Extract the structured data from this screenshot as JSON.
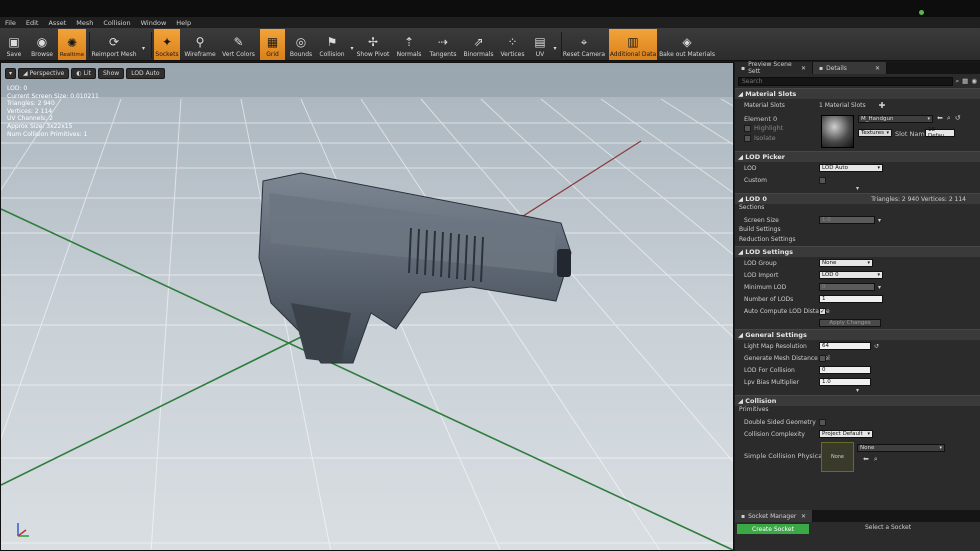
{
  "menu": [
    "File",
    "Edit",
    "Asset",
    "Mesh",
    "Collision",
    "Window",
    "Help"
  ],
  "toolbar": {
    "items": [
      {
        "label": "Save",
        "icon": "save-icon",
        "active": false
      },
      {
        "label": "Browse",
        "icon": "browse-icon",
        "active": false
      },
      {
        "label": "Reimport Mesh",
        "icon": "reimport-icon",
        "active": false
      },
      {
        "label": "Sockets",
        "icon": "sockets-icon",
        "active": true
      },
      {
        "label": "Wireframe",
        "icon": "wireframe-icon",
        "active": false
      },
      {
        "label": "Vert Colors",
        "icon": "vert-colors-icon",
        "active": false
      },
      {
        "label": "Grid",
        "icon": "grid-icon",
        "active": true
      },
      {
        "label": "Bounds",
        "icon": "bounds-icon",
        "active": false
      },
      {
        "label": "Collision",
        "icon": "collision-icon",
        "active": false
      },
      {
        "label": "Show Pivot",
        "icon": "pivot-icon",
        "active": false
      },
      {
        "label": "Normals",
        "icon": "normals-icon",
        "active": false
      },
      {
        "label": "Tangents",
        "icon": "tangents-icon",
        "active": false
      },
      {
        "label": "Binormals",
        "icon": "binormals-icon",
        "active": false
      },
      {
        "label": "Vertices",
        "icon": "vertices-icon",
        "active": false
      },
      {
        "label": "UV",
        "icon": "uv-icon",
        "active": false
      },
      {
        "label": "Reset Camera",
        "icon": "reset-camera-icon",
        "active": false
      },
      {
        "label": "Additional Data",
        "icon": "additional-data-icon",
        "active": true
      },
      {
        "label": "Bake out Materials",
        "icon": "bake-materials-icon",
        "active": false
      }
    ]
  },
  "viewport": {
    "buttons": {
      "perspective": "Perspective",
      "lit": "Lit",
      "show": "Show",
      "lod": "LOD Auto"
    },
    "stats": [
      "LOD: 0",
      "Current Screen Size: 0.010211",
      "Triangles: 2 940",
      "Vertices: 2 114",
      "UV Channels: 2",
      "Approx Size: 3x22x15",
      "Num Collision Primitives: 1"
    ]
  },
  "panel_tabs": {
    "preview": "Preview Scene Sett",
    "details": "Details"
  },
  "details": {
    "search_placeholder": "Search",
    "material_slots": {
      "title": "Material Slots",
      "label": "Material Slots",
      "count": "1 Material Slots",
      "element": "Element 0",
      "highlight": "Highlight",
      "isolate": "Isolate",
      "material": "M_Handgun",
      "textures": "Textures",
      "slot_name_label": "Slot Name",
      "slot_name": "18 - Defau"
    },
    "lod_picker": {
      "title": "LOD Picker",
      "lod_label": "LOD",
      "lod_value": "LOD Auto",
      "custom_label": "Custom"
    },
    "lod0": {
      "title": "LOD 0",
      "stats": "Triangles: 2 940    Vertices: 2 114",
      "sections": "Sections",
      "screen_size_label": "Screen Size",
      "screen_size": "1.0",
      "build_settings": "Build Settings",
      "reduction_settings": "Reduction Settings"
    },
    "lod_settings": {
      "title": "LOD Settings",
      "group_label": "LOD Group",
      "group": "None",
      "import_label": "LOD Import",
      "import": "LOD 0",
      "min_label": "Minimum LOD",
      "min": "0",
      "num_label": "Number of LODs",
      "num": "1",
      "auto_label": "Auto Compute LOD Distance",
      "apply": "Apply Changes"
    },
    "general": {
      "title": "General Settings",
      "lightmap_label": "Light Map Resolution",
      "lightmap": "64",
      "distfield_label": "Generate Mesh Distance Fiel",
      "lodcoll_label": "LOD For Collision",
      "lodcoll": "0",
      "lpv_label": "Lpv Bias Multiplier",
      "lpv": "1.0"
    },
    "collision": {
      "title": "Collision",
      "primitives": "Primitives",
      "double_label": "Double Sided Geometry",
      "complexity_label": "Collision Complexity",
      "complexity": "Project Default",
      "simple_label": "Simple Collision Physical Ma",
      "thumb": "None",
      "phys_value": "None"
    }
  },
  "socket": {
    "tab": "Socket Manager",
    "create": "Create Socket",
    "select": "Select a Socket"
  }
}
